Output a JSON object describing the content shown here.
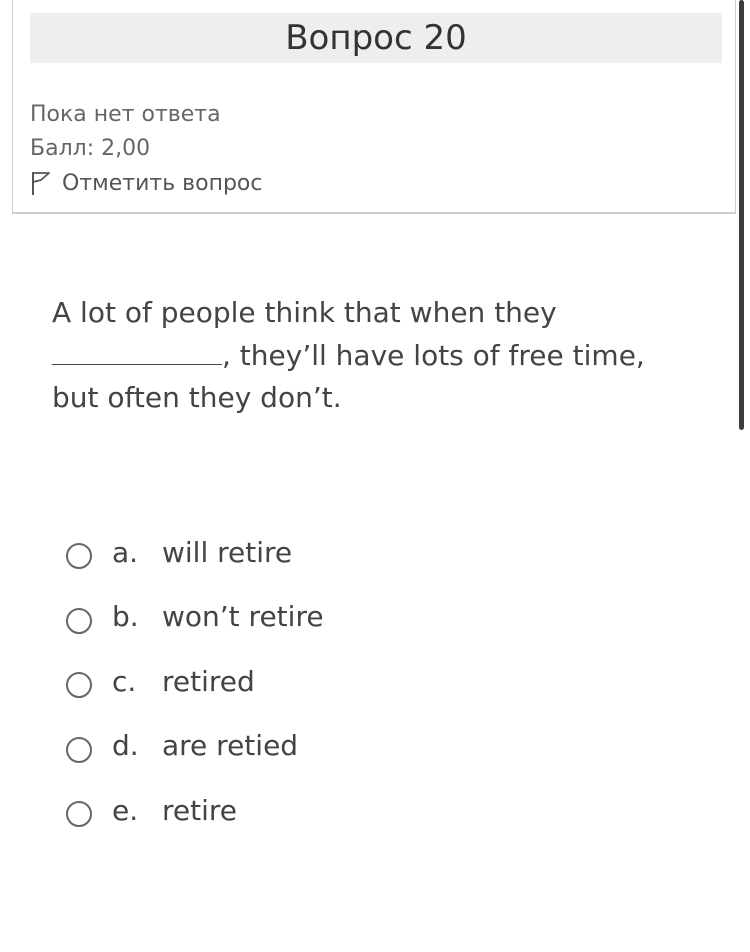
{
  "question_info": {
    "title": "Вопрос 20",
    "state": "Пока нет ответа",
    "grade": "Балл: 2,00",
    "flag_label": "Отметить вопрос",
    "flag_icon": "flag-icon"
  },
  "question": {
    "text_before_blank": "A lot of people think that when they",
    "text_after_blank": ", they’ll have lots of free time, but often they don’t."
  },
  "answers": [
    {
      "letter": "a.",
      "text": "will retire",
      "selected": false
    },
    {
      "letter": "b.",
      "text": "won’t retire",
      "selected": false
    },
    {
      "letter": "c.",
      "text": "retired",
      "selected": false
    },
    {
      "letter": "d.",
      "text": "are retied",
      "selected": false
    },
    {
      "letter": "e.",
      "text": "retire",
      "selected": false
    }
  ]
}
